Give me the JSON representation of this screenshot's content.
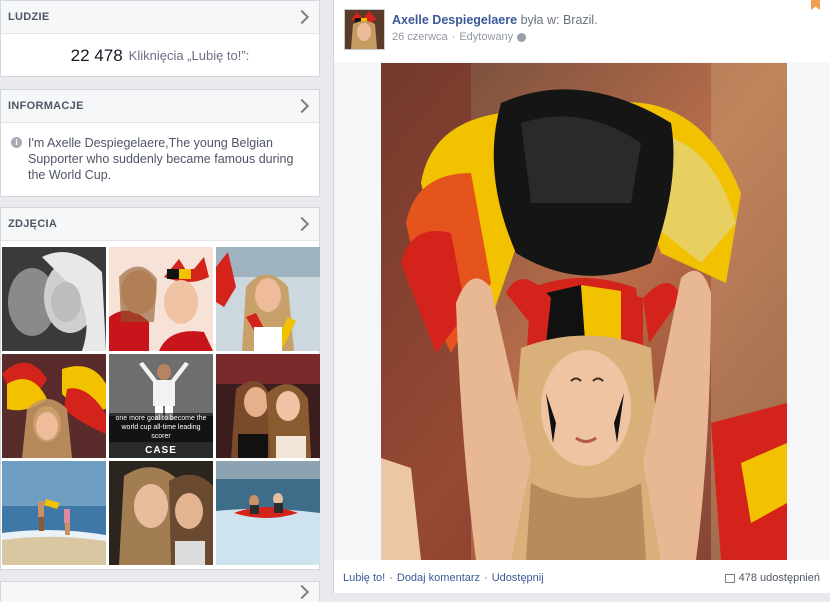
{
  "people": {
    "title": "LUDZIE",
    "likes_count": "22 478",
    "likes_label": "Kliknięcia „Lubię to!”:"
  },
  "info": {
    "title": "INFORMACJE",
    "text": "I'm Axelle Despiegelaere,The young Belgian Supporter who suddenly became famous during the World Cup."
  },
  "photos": {
    "title": "ZDJĘCIA",
    "items": [
      {
        "alt": "Black and white selfie of two girls"
      },
      {
        "alt": "Two girls in Belgian fan hats"
      },
      {
        "alt": "Girl with scarf at stadium"
      },
      {
        "alt": "Fans with pom-poms"
      },
      {
        "alt": "Football player meme",
        "caption": "one more goal to become the world cup all-time leading scorer",
        "tag": "CASE"
      },
      {
        "alt": "Two girls at night"
      },
      {
        "alt": "Two people on the beach"
      },
      {
        "alt": "Girl portrait"
      },
      {
        "alt": "Couple on a boat ride"
      }
    ]
  },
  "post": {
    "author": "Axelle Despiegelaere",
    "location_text": "była w: Brazil.",
    "date": "26 czerwca",
    "edited": "Edytowany",
    "actions": {
      "like": "Lubię to!",
      "comment": "Dodaj komentarz",
      "share": "Udostępnij"
    },
    "shares_count": "478 udostępnień"
  },
  "colors": {
    "link": "#3b5998",
    "belgium_black": "#111111",
    "belgium_yellow": "#f2c200",
    "belgium_red": "#d4231b"
  }
}
